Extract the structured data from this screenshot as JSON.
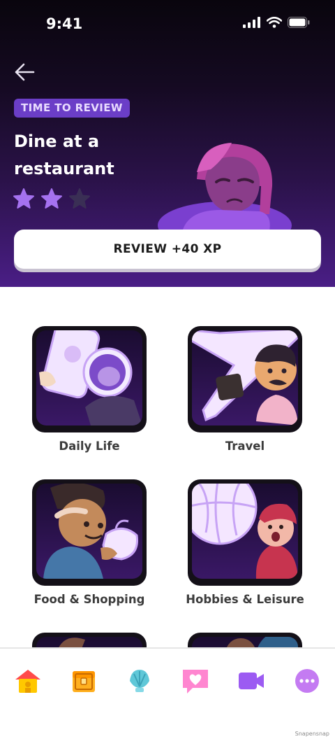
{
  "status_bar": {
    "time": "9:41"
  },
  "hero": {
    "badge": "TIME TO REVIEW",
    "title_line1": "Dine at a",
    "title_line2": "restaurant",
    "stars": {
      "earned": 2,
      "total": 3
    },
    "review_button": "REVIEW +40 XP"
  },
  "topics": [
    {
      "label": "Daily Life"
    },
    {
      "label": "Travel"
    },
    {
      "label": "Food & Shopping"
    },
    {
      "label": "Hobbies & Leisure"
    }
  ],
  "tab_bar": {
    "items": [
      {
        "icon": "home-icon"
      },
      {
        "icon": "treasure-chest-icon"
      },
      {
        "icon": "shell-icon"
      },
      {
        "icon": "heart-chat-icon"
      },
      {
        "icon": "video-camera-icon"
      },
      {
        "icon": "more-icon"
      }
    ]
  },
  "watermark": "Snapensnap",
  "colors": {
    "badge_bg": "#6b3ec7",
    "star_filled": "#a572f0",
    "star_empty": "#3a2f55",
    "tile_bg": "#2a1248"
  }
}
